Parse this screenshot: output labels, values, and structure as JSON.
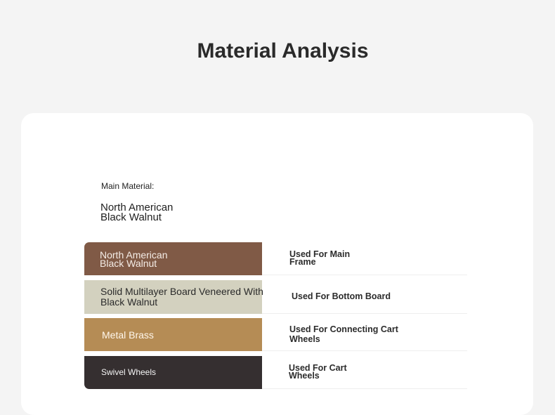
{
  "page": {
    "title": "Material Analysis"
  },
  "main_material": {
    "label": "Main Material:",
    "value_line1": "North American",
    "value_line2": "Black Walnut"
  },
  "materials": [
    {
      "name_line1": "North American",
      "name_line2": "Black Walnut",
      "usage_line1": "Used For Main",
      "usage_line2": "Frame",
      "color": "#805a46"
    },
    {
      "name_line1": "Solid Multilayer Board Veneered With",
      "name_line2": "Black Walnut",
      "usage_line1": "Used For Bottom Board",
      "usage_line2": "",
      "color": "#d3d1bf"
    },
    {
      "name_line1": "Metal Brass",
      "name_line2": "",
      "usage_line1": "Used For Connecting Cart",
      "usage_line2": "Wheels",
      "color": "#b58c55"
    },
    {
      "name_line1": "Swivel Wheels",
      "name_line2": "",
      "usage_line1": "Used For Cart",
      "usage_line2": "Wheels",
      "color": "#352f30"
    }
  ]
}
